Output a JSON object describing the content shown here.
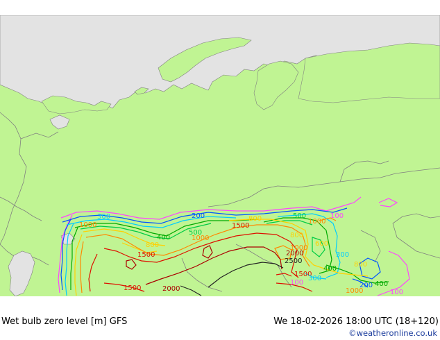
{
  "footer": {
    "title": "Wet bulb zero level [m] GFS",
    "time": "We 18-02-2026 18:00 UTC (18+120)",
    "credit": "©weatheronline.co.uk"
  },
  "colors": {
    "land": "#c0f493",
    "sea_ice": "#e3e3e3",
    "border": "#808080",
    "contour_100": "#ff44ff",
    "contour_200": "#0055ff",
    "contour_300": "#00ccff",
    "contour_400": "#00aa00",
    "contour_500": "#00cc44",
    "contour_800": "#ffd000",
    "contour_1000": "#ff8800",
    "contour_1500": "#dd1100",
    "contour_2000": "#aa0000",
    "contour_2500": "#222222"
  },
  "contour_labels": [
    {
      "text": "300",
      "level": 300
    },
    {
      "text": "1000",
      "level": 1000
    },
    {
      "text": "200",
      "level": 200
    },
    {
      "text": "400",
      "level": 400
    },
    {
      "text": "500",
      "level": 500
    },
    {
      "text": "1000",
      "level": 1000
    },
    {
      "text": "800",
      "level": 800
    },
    {
      "text": "1500",
      "level": 1500
    },
    {
      "text": "1500",
      "level": 1500
    },
    {
      "text": "800",
      "level": 800
    },
    {
      "text": "500",
      "level": 500
    },
    {
      "text": "1000",
      "level": 1000
    },
    {
      "text": "100",
      "level": 100
    },
    {
      "text": "800",
      "level": 800
    },
    {
      "text": "1000",
      "level": 1000
    },
    {
      "text": "600",
      "level": 800
    },
    {
      "text": "300",
      "level": 300
    },
    {
      "text": "2000",
      "level": 2000
    },
    {
      "text": "2500",
      "level": 2500
    },
    {
      "text": "400",
      "level": 400
    },
    {
      "text": "800",
      "level": 800
    },
    {
      "text": "1500",
      "level": 1500
    },
    {
      "text": "100",
      "level": 100
    },
    {
      "text": "300",
      "level": 300
    },
    {
      "text": "1500",
      "level": 1500
    },
    {
      "text": "2000",
      "level": 2000
    },
    {
      "text": "200",
      "level": 200
    },
    {
      "text": "400",
      "level": 400
    },
    {
      "text": "100",
      "level": 100
    },
    {
      "text": "1000",
      "level": 1000
    }
  ]
}
